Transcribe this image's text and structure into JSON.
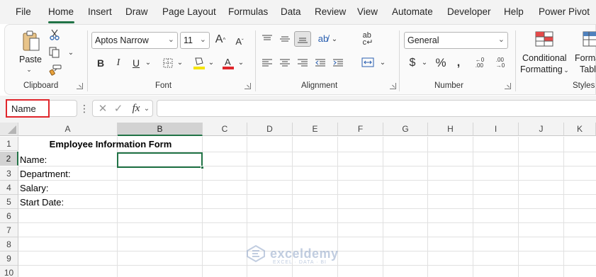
{
  "menu": {
    "tabs": [
      "File",
      "Home",
      "Insert",
      "Draw",
      "Page Layout",
      "Formulas",
      "Data",
      "Review",
      "View",
      "Automate",
      "Developer",
      "Help",
      "Power Pivot"
    ],
    "active": "Home"
  },
  "ribbon": {
    "clipboard": {
      "label": "Clipboard",
      "paste_label": "Paste"
    },
    "font": {
      "label": "Font",
      "font_name": "Aptos Narrow",
      "font_size": "11"
    },
    "alignment": {
      "label": "Alignment"
    },
    "number": {
      "label": "Number",
      "format": "General"
    },
    "styles": {
      "label": "Styles",
      "conditional_formatting": "Conditional",
      "conditional_formatting_2": "Formatting",
      "format_as_table": "Format",
      "format_as_table_2": "Table"
    }
  },
  "formula_bar": {
    "name_box": "Name",
    "fx": "fx",
    "formula": ""
  },
  "grid": {
    "columns": [
      "A",
      "B",
      "C",
      "D",
      "E",
      "F",
      "G",
      "H",
      "I",
      "J",
      "K"
    ],
    "rows": [
      "1",
      "2",
      "3",
      "4",
      "5",
      "6",
      "7",
      "8",
      "9",
      "10"
    ],
    "selected_column": "B",
    "selected_row": "2",
    "cells": {
      "A1": "Employee Information Form",
      "A2": "Name:",
      "A3": "Department:",
      "A4": "Salary:",
      "A5": "Start Date:"
    }
  },
  "watermark": {
    "name": "exceldemy",
    "tagline": "EXCEL · DATA · BI"
  },
  "colors": {
    "accent": "#217346",
    "highlight": "#e0262b",
    "font_color_bar": "#e0262b",
    "fill_color_bar": "#f5e400"
  }
}
